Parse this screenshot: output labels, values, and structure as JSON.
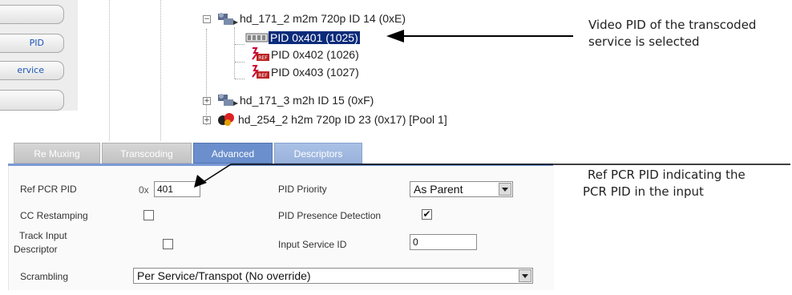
{
  "nav": {
    "buttons": [
      {
        "label": ""
      },
      {
        "label": "PID"
      },
      {
        "label": "ervice"
      },
      {
        "label": ""
      }
    ]
  },
  "tree": {
    "items": [
      {
        "label": "hd_171_2 m2m 720p ID 14 (0xE)",
        "icon": "transcoded-service-icon"
      },
      {
        "label": "PID 0x401 (1025)",
        "icon": "video-pid-icon",
        "selected": true
      },
      {
        "label": "PID 0x402 (1026)",
        "icon": "ref-pid-icon"
      },
      {
        "label": "PID 0x403 (1027)",
        "icon": "ref-pid-icon"
      },
      {
        "label": "hd_171_3 m2h ID 15 (0xF)",
        "icon": "transcoded-service-icon"
      },
      {
        "label": "hd_254_2 h2m 720p  ID 23 (0x17)  [Pool 1]",
        "icon": "pool-service-icon"
      }
    ]
  },
  "tabs": [
    {
      "label": "Re Muxing",
      "active": false
    },
    {
      "label": "Transcoding",
      "active": false
    },
    {
      "label": "Advanced",
      "active": true
    },
    {
      "label": "Descriptors",
      "active": false
    }
  ],
  "form": {
    "ref_pcr_pid": {
      "label": "Ref PCR PID",
      "prefix": "0x",
      "value": "401"
    },
    "pid_priority": {
      "label": "PID Priority",
      "value": "As Parent"
    },
    "cc_restamping": {
      "label": "CC Restamping",
      "checked": false
    },
    "pid_presence": {
      "label": "PID Presence Detection",
      "checked": true
    },
    "track_input": {
      "label_line1": "Track Input",
      "label_line2": "Descriptor",
      "checked": false
    },
    "input_service_id": {
      "label": "Input Service ID",
      "value": "0"
    },
    "scrambling": {
      "label": "Scrambling",
      "value": "Per Service/Transpot (No override)"
    }
  },
  "annotations": {
    "video_pid": {
      "line1": "Video PID of the transcoded",
      "line2": "service is selected"
    },
    "ref_pcr": {
      "line1": "Ref PCR PID indicating the",
      "line2": "PCR PID in the input"
    }
  },
  "colors": {
    "selection": "#0a2b7a",
    "active_tab": "#6b8fcc",
    "form_bar": "#7b9ad6"
  }
}
